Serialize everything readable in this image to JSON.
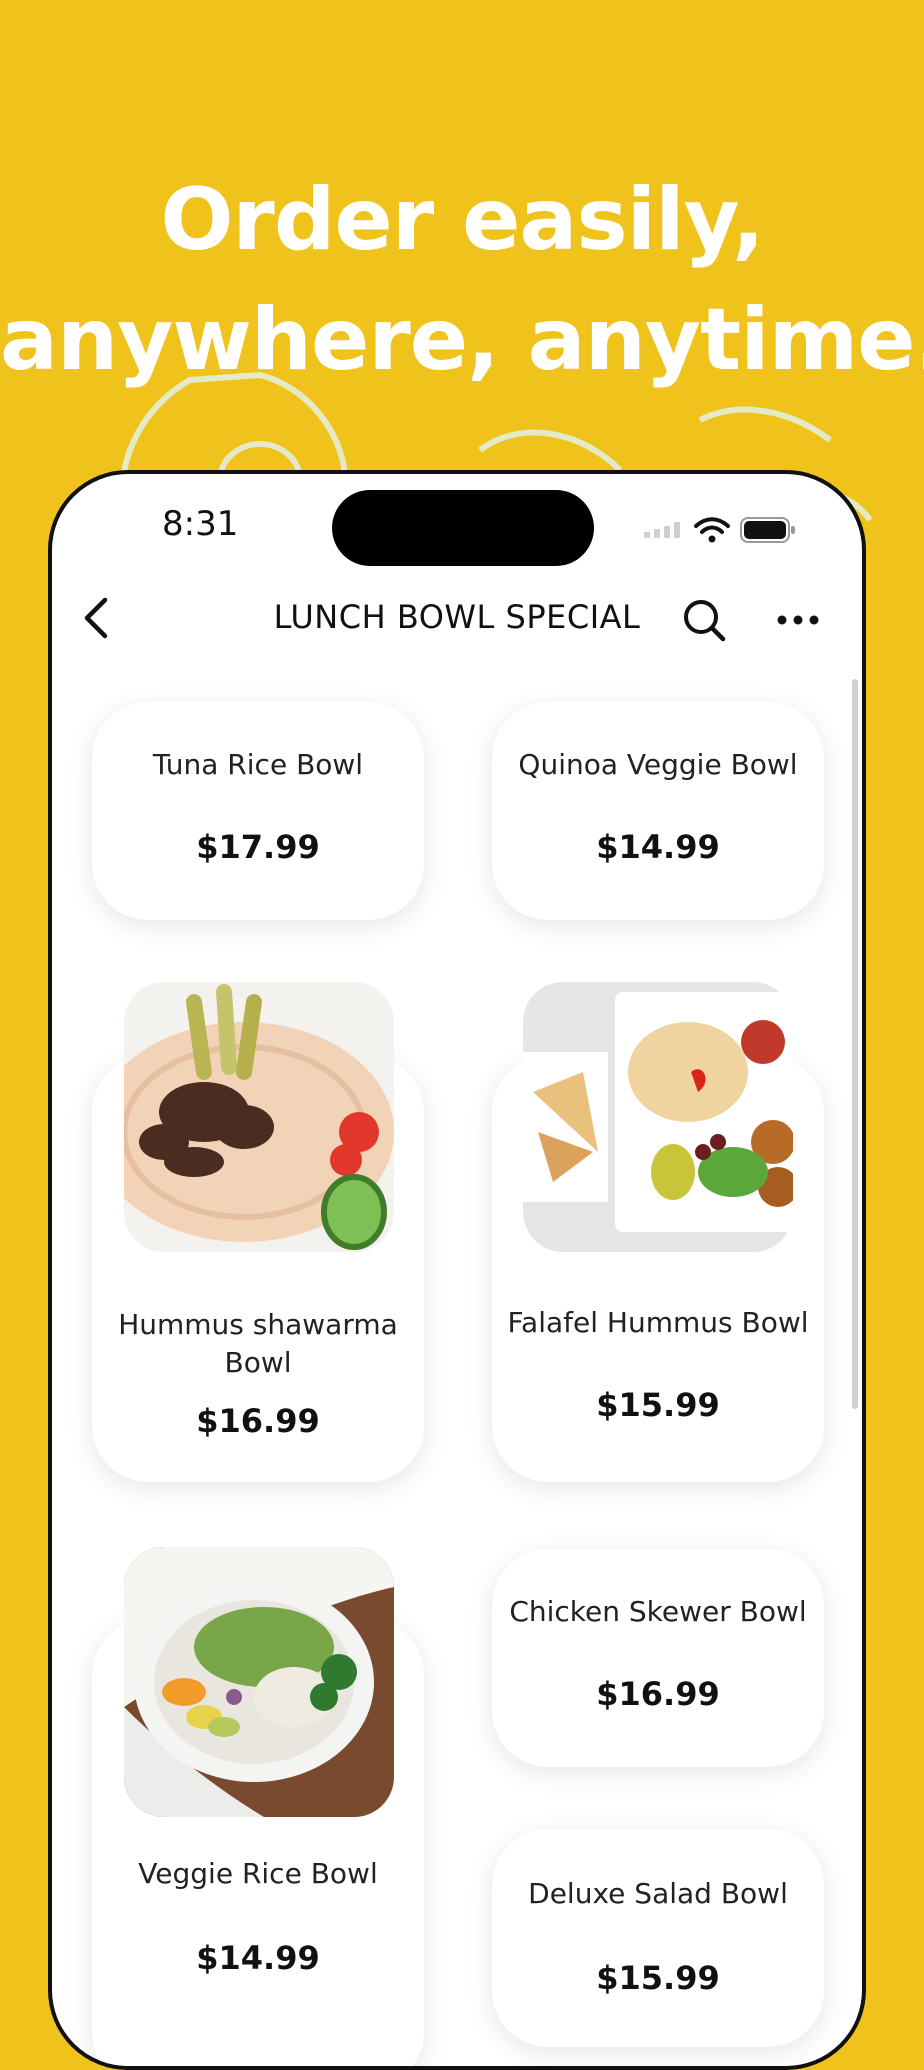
{
  "headline": {
    "line1": "Order easily,",
    "line2": "anywhere, anytime."
  },
  "status_bar": {
    "time": "8:31"
  },
  "navbar": {
    "title": "LUNCH BOWL SPECIAL"
  },
  "colors": {
    "background": "#F0C31C",
    "card": "#FFFFFF",
    "text": "#111111"
  },
  "menu_items": [
    {
      "name": "Tuna Rice Bowl",
      "price": "$17.99"
    },
    {
      "name": "Quinoa Veggie Bowl",
      "price": "$14.99"
    },
    {
      "name": "Hummus shawarma Bowl",
      "price": "$16.99"
    },
    {
      "name": "Falafel Hummus Bowl",
      "price": "$15.99"
    },
    {
      "name": "Veggie Rice Bowl",
      "price": "$14.99"
    },
    {
      "name": "Chicken Skewer Bowl",
      "price": "$16.99"
    },
    {
      "name": "Deluxe Salad Bowl",
      "price": "$15.99"
    }
  ]
}
